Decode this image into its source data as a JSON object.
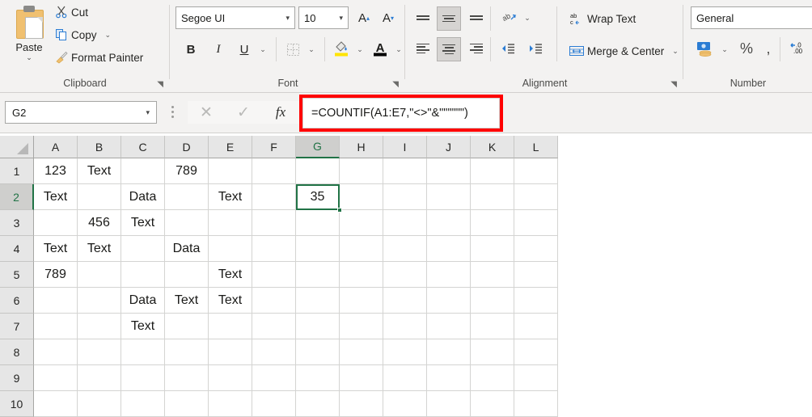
{
  "ribbon": {
    "clipboard": {
      "label": "Clipboard",
      "paste": "Paste",
      "cut": "Cut",
      "copy": "Copy",
      "format_painter": "Format Painter"
    },
    "font": {
      "label": "Font",
      "font_name": "Segoe UI",
      "font_size": "10",
      "bold": "B",
      "italic": "I",
      "underline": "U"
    },
    "alignment": {
      "label": "Alignment",
      "wrap_text": "Wrap Text",
      "merge_center": "Merge & Center"
    },
    "number": {
      "label": "Number",
      "format": "General",
      "percent": "%",
      "comma": ","
    }
  },
  "formula_bar": {
    "name_box": "G2",
    "formula": "=COUNTIF(A1:E7,\"<>\"&\"\"\"\"\"\")"
  },
  "sheet": {
    "columns": [
      "A",
      "B",
      "C",
      "D",
      "E",
      "F",
      "G",
      "H",
      "I",
      "J",
      "K",
      "L"
    ],
    "selected_column": "G",
    "rows": [
      "1",
      "2",
      "3",
      "4",
      "5",
      "6",
      "7",
      "8",
      "9",
      "10"
    ],
    "selected_row": "2",
    "active_cell": "G2",
    "cells": {
      "A1": "123",
      "B1": "Text",
      "D1": "789",
      "A2": "Text",
      "C2": "Data",
      "E2": "Text",
      "G2": "35",
      "B3": "456",
      "C3": "Text",
      "A4": "Text",
      "B4": "Text",
      "D4": "Data",
      "A5": "789",
      "E5": "Text",
      "C6": "Data",
      "D6": "Text",
      "E6": "Text",
      "C7": "Text"
    }
  },
  "colors": {
    "excel_green": "#217346",
    "highlight_red": "#ff0000",
    "ribbon_bg": "#f3f2f1"
  }
}
